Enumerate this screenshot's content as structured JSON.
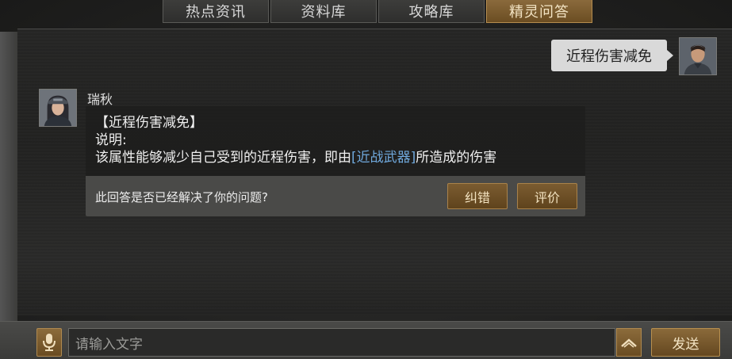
{
  "tabs": [
    {
      "label": "热点资讯",
      "active": false
    },
    {
      "label": "资料库",
      "active": false
    },
    {
      "label": "攻略库",
      "active": false
    },
    {
      "label": "精灵问答",
      "active": true
    }
  ],
  "conversation": {
    "user_message": "近程伤害减免",
    "npc_name": "瑞秋",
    "answer": {
      "title": "【近程伤害减免】",
      "label": "说明:",
      "body_prefix": "该属性能够减少自己受到的近程伤害，即由",
      "body_link": "[近战武器]",
      "body_suffix": "所造成的伤害"
    },
    "feedback": {
      "question": "此回答是否已经解决了你的问题?",
      "correct_label": "纠错",
      "rate_label": "评价"
    }
  },
  "input_bar": {
    "placeholder": "请输入文字",
    "send_label": "发送",
    "mic_icon": "microphone-icon",
    "expand_icon": "chevron-up-icon"
  },
  "colors": {
    "accent_gold": "#8a6a3a",
    "link_blue": "#6fa8dc",
    "bubble_gray": "#d9d9d9"
  }
}
